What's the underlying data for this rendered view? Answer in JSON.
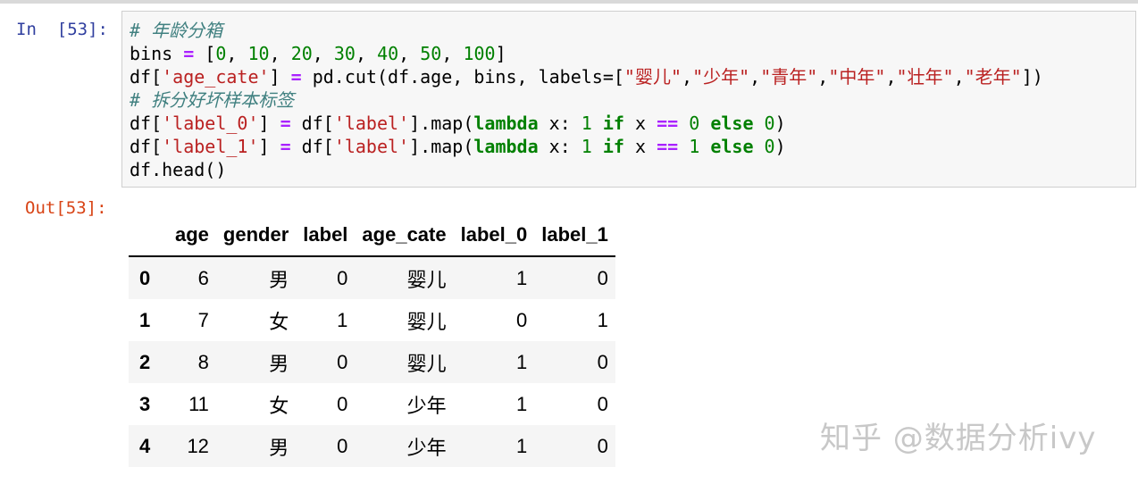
{
  "cell": {
    "input_prompt": "In  [53]:",
    "output_prompt": "Out[53]:",
    "code_lines": [
      [
        {
          "c": "cm",
          "t": "# 年龄分箱"
        }
      ],
      [
        {
          "c": "pn",
          "t": "bins "
        },
        {
          "c": "op",
          "t": "="
        },
        {
          "c": "pn",
          "t": " ["
        },
        {
          "c": "num",
          "t": "0"
        },
        {
          "c": "pn",
          "t": ", "
        },
        {
          "c": "num",
          "t": "10"
        },
        {
          "c": "pn",
          "t": ", "
        },
        {
          "c": "num",
          "t": "20"
        },
        {
          "c": "pn",
          "t": ", "
        },
        {
          "c": "num",
          "t": "30"
        },
        {
          "c": "pn",
          "t": ", "
        },
        {
          "c": "num",
          "t": "40"
        },
        {
          "c": "pn",
          "t": ", "
        },
        {
          "c": "num",
          "t": "50"
        },
        {
          "c": "pn",
          "t": ", "
        },
        {
          "c": "num",
          "t": "100"
        },
        {
          "c": "pn",
          "t": "]"
        }
      ],
      [
        {
          "c": "pn",
          "t": "df["
        },
        {
          "c": "str",
          "t": "'age_cate'"
        },
        {
          "c": "pn",
          "t": "] "
        },
        {
          "c": "op",
          "t": "="
        },
        {
          "c": "pn",
          "t": " pd.cut(df.age, bins, labels=["
        },
        {
          "c": "str",
          "t": "\"婴儿\""
        },
        {
          "c": "pn",
          "t": ","
        },
        {
          "c": "str",
          "t": "\"少年\""
        },
        {
          "c": "pn",
          "t": ","
        },
        {
          "c": "str",
          "t": "\"青年\""
        },
        {
          "c": "pn",
          "t": ","
        },
        {
          "c": "str",
          "t": "\"中年\""
        },
        {
          "c": "pn",
          "t": ","
        },
        {
          "c": "str",
          "t": "\"壮年\""
        },
        {
          "c": "pn",
          "t": ","
        },
        {
          "c": "str",
          "t": "\"老年\""
        },
        {
          "c": "pn",
          "t": "])"
        }
      ],
      [
        {
          "c": "cm",
          "t": "# 拆分好坏样本标签"
        }
      ],
      [
        {
          "c": "pn",
          "t": "df["
        },
        {
          "c": "str",
          "t": "'label_0'"
        },
        {
          "c": "pn",
          "t": "] "
        },
        {
          "c": "op",
          "t": "="
        },
        {
          "c": "pn",
          "t": " df["
        },
        {
          "c": "str",
          "t": "'label'"
        },
        {
          "c": "pn",
          "t": "].map("
        },
        {
          "c": "kw",
          "t": "lambda"
        },
        {
          "c": "pn",
          "t": " x: "
        },
        {
          "c": "num",
          "t": "1"
        },
        {
          "c": "pn",
          "t": " "
        },
        {
          "c": "kw",
          "t": "if"
        },
        {
          "c": "pn",
          "t": " x "
        },
        {
          "c": "op",
          "t": "=="
        },
        {
          "c": "pn",
          "t": " "
        },
        {
          "c": "num",
          "t": "0"
        },
        {
          "c": "pn",
          "t": " "
        },
        {
          "c": "kw",
          "t": "else"
        },
        {
          "c": "pn",
          "t": " "
        },
        {
          "c": "num",
          "t": "0"
        },
        {
          "c": "pn",
          "t": ")"
        }
      ],
      [
        {
          "c": "pn",
          "t": "df["
        },
        {
          "c": "str",
          "t": "'label_1'"
        },
        {
          "c": "pn",
          "t": "] "
        },
        {
          "c": "op",
          "t": "="
        },
        {
          "c": "pn",
          "t": " df["
        },
        {
          "c": "str",
          "t": "'label'"
        },
        {
          "c": "pn",
          "t": "].map("
        },
        {
          "c": "kw",
          "t": "lambda"
        },
        {
          "c": "pn",
          "t": " x: "
        },
        {
          "c": "num",
          "t": "1"
        },
        {
          "c": "pn",
          "t": " "
        },
        {
          "c": "kw",
          "t": "if"
        },
        {
          "c": "pn",
          "t": " x "
        },
        {
          "c": "op",
          "t": "=="
        },
        {
          "c": "pn",
          "t": " "
        },
        {
          "c": "num",
          "t": "1"
        },
        {
          "c": "pn",
          "t": " "
        },
        {
          "c": "kw",
          "t": "else"
        },
        {
          "c": "pn",
          "t": " "
        },
        {
          "c": "num",
          "t": "0"
        },
        {
          "c": "pn",
          "t": ")"
        }
      ],
      [
        {
          "c": "pn",
          "t": "df.head()"
        }
      ]
    ]
  },
  "table": {
    "columns": [
      "",
      "age",
      "gender",
      "label",
      "age_cate",
      "label_0",
      "label_1"
    ],
    "rows": [
      {
        "index": "0",
        "age": "6",
        "gender": "男",
        "label": "0",
        "age_cate": "婴儿",
        "label_0": "1",
        "label_1": "0"
      },
      {
        "index": "1",
        "age": "7",
        "gender": "女",
        "label": "1",
        "age_cate": "婴儿",
        "label_0": "0",
        "label_1": "1"
      },
      {
        "index": "2",
        "age": "8",
        "gender": "男",
        "label": "0",
        "age_cate": "婴儿",
        "label_0": "1",
        "label_1": "0"
      },
      {
        "index": "3",
        "age": "11",
        "gender": "女",
        "label": "0",
        "age_cate": "少年",
        "label_0": "1",
        "label_1": "0"
      },
      {
        "index": "4",
        "age": "12",
        "gender": "男",
        "label": "0",
        "age_cate": "少年",
        "label_0": "1",
        "label_1": "0"
      }
    ]
  },
  "watermark": "知乎 @数据分析ivy",
  "colors": {
    "input_prompt": "#303f9f",
    "output_prompt": "#d84315",
    "comment": "#408080",
    "number": "#008000",
    "string": "#ba2121",
    "keyword": "#008000",
    "operator": "#aa22ff"
  }
}
